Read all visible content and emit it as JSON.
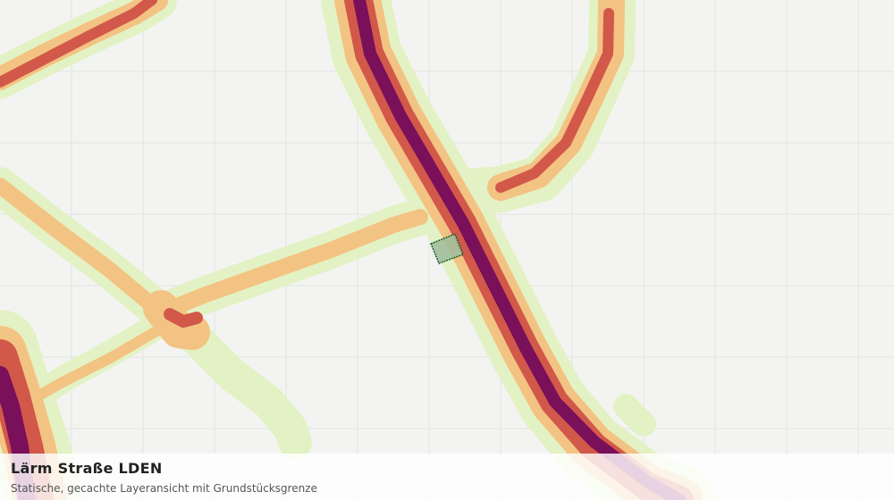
{
  "map": {
    "title": "Lärm Straße LDEN",
    "subtitle": "Statische, gecachte Layeransicht mit Grundstücksgrenze"
  },
  "legend_colors": {
    "background": "#f3f4f2",
    "grid": "#e2e4e1",
    "band_lowest": "#e3f2c4",
    "band_low": "#f3c383",
    "band_mid": "#d2584a",
    "band_high": "#7a0f5a",
    "parcel_fill": "#9dbc9c",
    "parcel_stroke": "#1f5a2a"
  }
}
